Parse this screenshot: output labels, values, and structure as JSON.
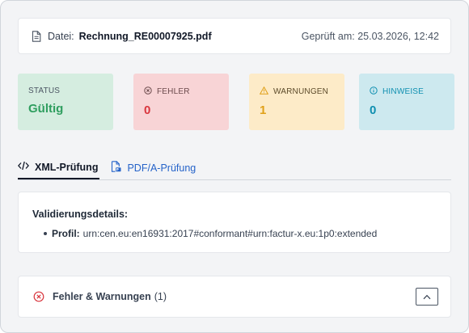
{
  "file": {
    "label": "Datei:",
    "name": "Rechnung_RE00007925.pdf",
    "checked": "Geprüft am: 25.03.2026, 12:42"
  },
  "stats": {
    "status": {
      "label": "STATUS",
      "value": "Gültig",
      "color": "#2f9e5f"
    },
    "errors": {
      "label": "FEHLER",
      "value": "0",
      "color": "#d9363e",
      "icon": "x-circle-icon"
    },
    "warnings": {
      "label": "WARNUNGEN",
      "value": "1",
      "color": "#e0a019",
      "icon": "warning-triangle-icon"
    },
    "hints": {
      "label": "HINWEISE",
      "value": "0",
      "color": "#0f8fb0",
      "icon": "info-circle-icon"
    }
  },
  "tabs": [
    {
      "label": "XML-Prüfung",
      "icon": "code-icon",
      "active": true
    },
    {
      "label": "PDF/A-Prüfung",
      "icon": "pdf-file-icon",
      "active": false
    }
  ],
  "details": {
    "title": "Validierungsdetails:",
    "items": [
      {
        "key": "Profil:",
        "value": "urn:cen.eu:en16931:2017#conformant#urn:factur-x.eu:1p0:extended"
      }
    ]
  },
  "issues": {
    "title": "Fehler & Warnungen",
    "count": "(1)",
    "icon": "x-circle-icon",
    "expanded": true
  }
}
